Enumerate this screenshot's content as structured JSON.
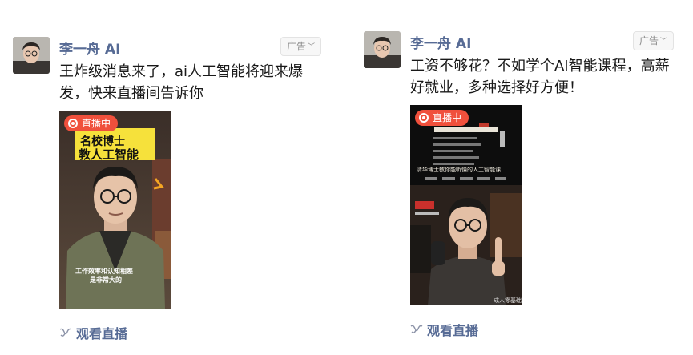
{
  "posts": [
    {
      "author": "李一舟 AI",
      "ad_label": "广告",
      "content": "王炸级消息来了，ai人工智能将迎来爆发，快来直播间告诉你",
      "live_label": "直播中",
      "video_title_1": "名校博士",
      "video_title_2": "教人工智能",
      "video_subtitle_1": "工作效率和认知相差",
      "video_subtitle_2": "是非常大的",
      "action_label": "观看直播"
    },
    {
      "author": "李一舟 AI",
      "ad_label": "广告",
      "content": "工资不够花？不如学个AI智能课程，高薪好就业，多种选择好方便！",
      "live_label": "直播中",
      "video_banner": "清华博士教你能听懂的人工智能课",
      "video_watermark": "成人零基础",
      "action_label": "观看直播"
    }
  ],
  "colors": {
    "link": "#576b95",
    "live_badge": "#f0503c",
    "text": "#191919"
  },
  "icons": [
    "chevron-down-icon",
    "live-broadcast-icon",
    "channels-icon"
  ]
}
